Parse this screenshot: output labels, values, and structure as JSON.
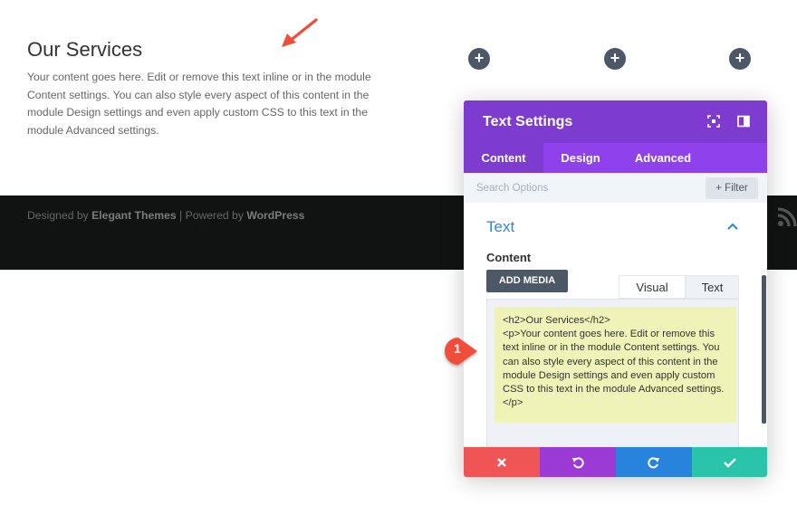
{
  "page": {
    "title": "Our Services",
    "text": "Your content goes here. Edit or remove this text inline or in the module Content settings. You can also style every aspect of this content in the module Design settings and even apply custom CSS to this text in the module Advanced settings."
  },
  "footer": {
    "designed_by": "Designed by",
    "designer": "Elegant Themes",
    "separator": " | Powered by ",
    "powered": "WordPress",
    "rss_icon": "rss-icon"
  },
  "add_buttons": [
    "+",
    "+",
    "+"
  ],
  "modal": {
    "title": "Text Settings",
    "tabs": [
      {
        "label": "Content",
        "active": true
      },
      {
        "label": "Design",
        "active": false
      },
      {
        "label": "Advanced",
        "active": false
      }
    ],
    "search": {
      "placeholder": "Search Options"
    },
    "filter_label": "+ Filter",
    "group_title": "Text",
    "content_label": "Content",
    "add_media": "ADD MEDIA",
    "editor_tabs": {
      "visual": "Visual",
      "text": "Text"
    },
    "code": "<h2>Our Services</h2>\n<p>Your content goes here. Edit or remove this text inline or in the module Content settings. You can also style every aspect of this content in the module Design settings and even apply custom CSS to this text in the module Advanced settings.</p>",
    "footer_buttons": [
      {
        "name": "cancel",
        "color": "#ef5555"
      },
      {
        "name": "undo",
        "color": "#9b3ad4"
      },
      {
        "name": "redo",
        "color": "#2883dc"
      },
      {
        "name": "save",
        "color": "#29c4a9"
      }
    ]
  },
  "annotation": {
    "badge": "1"
  },
  "colors": {
    "header": "#7e3bd0",
    "tabs": "#8f42ec",
    "accent": "#2b87da",
    "arrow": "#f04d3b"
  }
}
